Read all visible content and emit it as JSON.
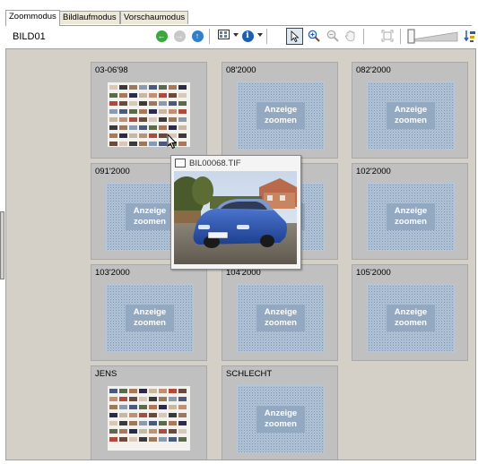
{
  "tabs": [
    {
      "label": "Zoommodus",
      "active": true
    },
    {
      "label": "Bildlaufmodus",
      "active": false
    },
    {
      "label": "Vorschaumodus",
      "active": false
    }
  ],
  "toolbar": {
    "folder_label": "BILD01",
    "icons": [
      "back-icon",
      "forward-icon",
      "up-icon",
      "view-mode-icon",
      "info-icon",
      "pointer-tool-icon",
      "zoom-in-icon",
      "zoom-out-icon",
      "pan-hand-icon",
      "fit-icon",
      "zoom-slider",
      "sort-icon"
    ]
  },
  "zoom_placeholder": {
    "line1": "Anzeige",
    "line2": "zoomen"
  },
  "folders": [
    {
      "name": "03-06'98",
      "kind": "thumbnails"
    },
    {
      "name": "08'2000",
      "kind": "zoom"
    },
    {
      "name": "082'2000",
      "kind": "zoom"
    },
    {
      "name": "091'2000",
      "kind": "zoom"
    },
    {
      "name": "",
      "kind": "zoom"
    },
    {
      "name": "102'2000",
      "kind": "zoom"
    },
    {
      "name": "103'2000",
      "kind": "zoom"
    },
    {
      "name": "104'2000",
      "kind": "zoom"
    },
    {
      "name": "105'2000",
      "kind": "zoom"
    },
    {
      "name": "JENS",
      "kind": "thumbnails"
    },
    {
      "name": "SCHLECHT",
      "kind": "zoom"
    }
  ],
  "preview": {
    "filename": "BIL00068.TIF"
  },
  "colors": {
    "panel_bg": "#d4d0c8",
    "cell_bg": "#c0c0c0",
    "zoom_badge": "#93a9c2",
    "car_blue": "#2d57b8"
  }
}
